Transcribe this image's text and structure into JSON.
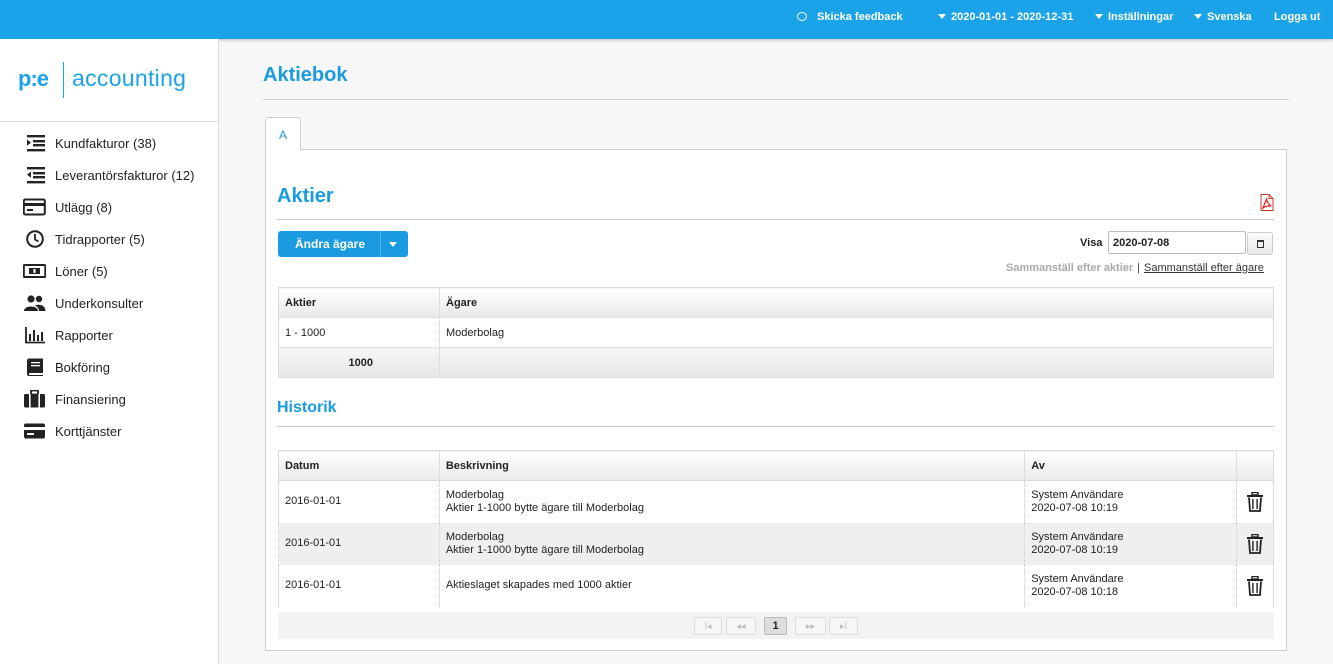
{
  "topbar": {
    "feedback": "Skicka feedback",
    "period": "2020-01-01 - 2020-12-31",
    "settings": "Inställningar",
    "language": "Svenska",
    "logout": "Logga ut"
  },
  "logo": {
    "mark": "p:e",
    "word": "accounting"
  },
  "sidebar": {
    "items": [
      {
        "label": "Kundfakturor (38)",
        "icon": "indent-right-icon"
      },
      {
        "label": "Leverantörsfakturor (12)",
        "icon": "indent-left-icon"
      },
      {
        "label": "Utlägg (8)",
        "icon": "credit-card-icon"
      },
      {
        "label": "Tidrapporter (5)",
        "icon": "clock-icon"
      },
      {
        "label": "Löner (5)",
        "icon": "money-icon"
      },
      {
        "label": "Underkonsulter",
        "icon": "users-icon"
      },
      {
        "label": "Rapporter",
        "icon": "bar-chart-icon"
      },
      {
        "label": "Bokföring",
        "icon": "book-icon"
      },
      {
        "label": "Finansiering",
        "icon": "briefcase-icon"
      },
      {
        "label": "Korttjänster",
        "icon": "card-icon"
      }
    ]
  },
  "page": {
    "title": "Aktiebok",
    "tab": "A"
  },
  "aktier": {
    "heading": "Aktier",
    "change_owner": "Ändra ägare",
    "visa_label": "Visa",
    "date": "2020-07-08",
    "link_by_shares": "Sammanställ efter aktier",
    "link_separator": "|",
    "link_by_owner": "Sammanställ efter ägare",
    "columns": [
      "Aktier",
      "Ägare"
    ],
    "rows": [
      {
        "shares": "1 - 1000",
        "owner": "Moderbolag"
      }
    ],
    "total": "1000"
  },
  "historik": {
    "heading": "Historik",
    "columns": [
      "Datum",
      "Beskrivning",
      "Av"
    ],
    "rows": [
      {
        "date": "2016-01-01",
        "desc1": "Moderbolag",
        "desc2": "Aktier 1-1000 bytte ägare till Moderbolag",
        "user": "System Användare",
        "time": "2020-07-08 10:19"
      },
      {
        "date": "2016-01-01",
        "desc1": "Moderbolag",
        "desc2": "Aktier 1-1000 bytte ägare till Moderbolag",
        "user": "System Användare",
        "time": "2020-07-08 10:19"
      },
      {
        "date": "2016-01-01",
        "desc1": "Aktieslaget skapades med 1000 aktier",
        "desc2": "",
        "user": "System Användare",
        "time": "2020-07-08 10:18"
      }
    ]
  },
  "pager": {
    "first": "I◂",
    "prev": "◂◂",
    "current": "1",
    "next": "▸▸",
    "last": "▸I"
  },
  "colors": {
    "accent": "#1aa3e8",
    "heading": "#1a9be0"
  }
}
